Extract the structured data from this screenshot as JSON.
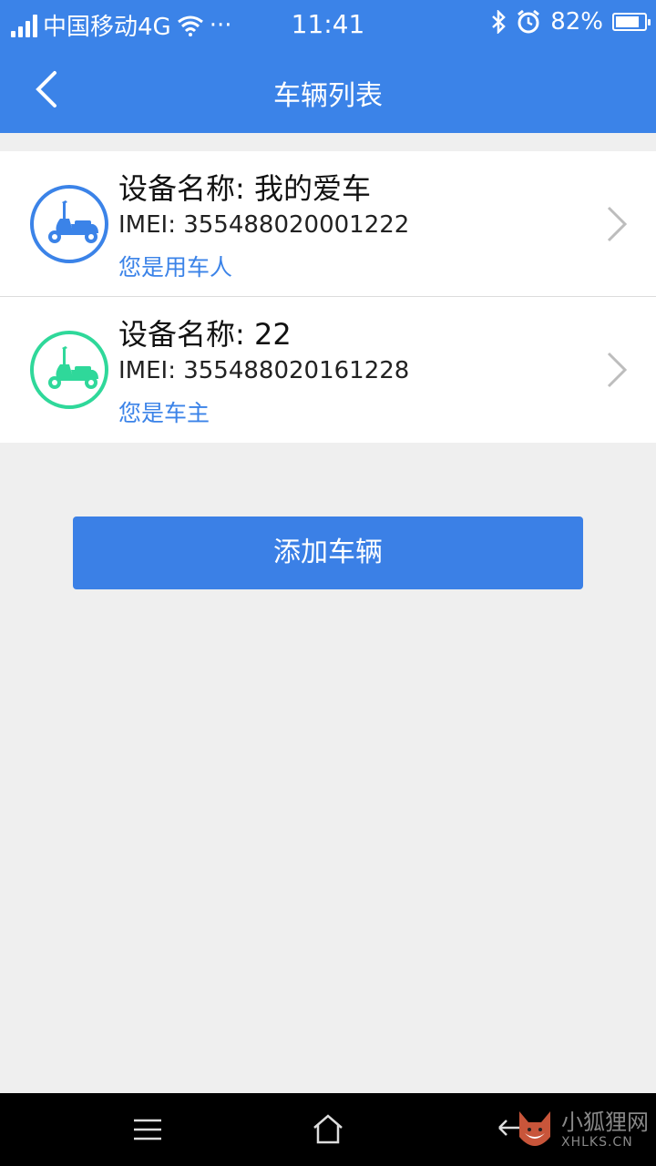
{
  "status_bar": {
    "carrier": "中国移动4G",
    "more": "···",
    "time": "11:41",
    "battery": "82%",
    "battery_level": 0.82,
    "icons": [
      "signal-icon",
      "wifi-icon",
      "bluetooth-icon",
      "alarm-icon",
      "battery-icon"
    ]
  },
  "nav": {
    "title": "车辆列表",
    "back_icon": "chevron-left-icon"
  },
  "vehicles": [
    {
      "name": "设备名称: 我的爱车",
      "imei": "IMEI: 355488020001222",
      "role": "您是用车人",
      "icon": "scooter-icon",
      "color": "#3b83e8"
    },
    {
      "name": "设备名称: 22",
      "imei": "IMEI: 355488020161228",
      "role": "您是车主",
      "icon": "scooter-icon",
      "color": "#2fd89a"
    }
  ],
  "add_button": "添加车辆",
  "system_nav": {
    "icons": [
      "menu-icon",
      "home-icon",
      "back-arrow-icon"
    ]
  },
  "watermark": {
    "cn": "小狐狸网",
    "en": "XHLKS.CN"
  },
  "colors": {
    "primary": "#3b83e8",
    "owner_green": "#2fd89a",
    "background": "#efefef"
  }
}
